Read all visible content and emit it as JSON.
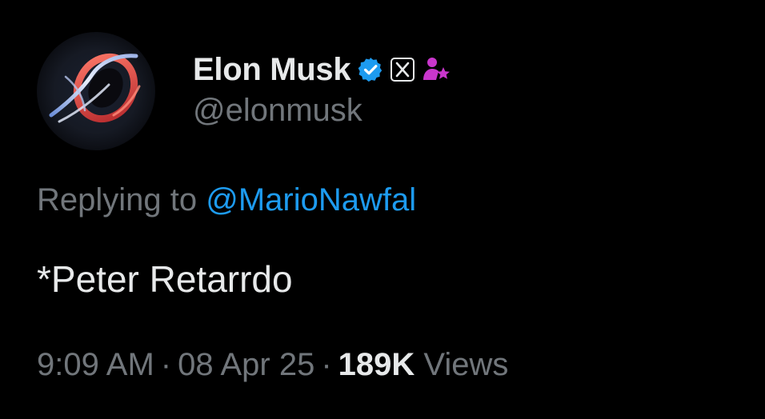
{
  "tweet": {
    "author": {
      "display_name": "Elon Musk",
      "handle": "@elonmusk",
      "badges": [
        "verified-badge-icon",
        "x-affiliate-badge-icon",
        "subscriber-star-icon"
      ]
    },
    "reply": {
      "prefix": "Replying to ",
      "to_handle": "@MarioNawfal"
    },
    "text": "*Peter Retarrdo",
    "meta": {
      "time": "9:09 AM",
      "separator": "·",
      "date": "08 Apr 25",
      "views_count": "189K",
      "views_label": "Views"
    }
  },
  "colors": {
    "background": "#000000",
    "primary_text": "#e7e9ea",
    "secondary_text": "#71767b",
    "link": "#1d9bf0",
    "verified": "#1d9bf0",
    "subscriber_badge": "#c936cc"
  }
}
